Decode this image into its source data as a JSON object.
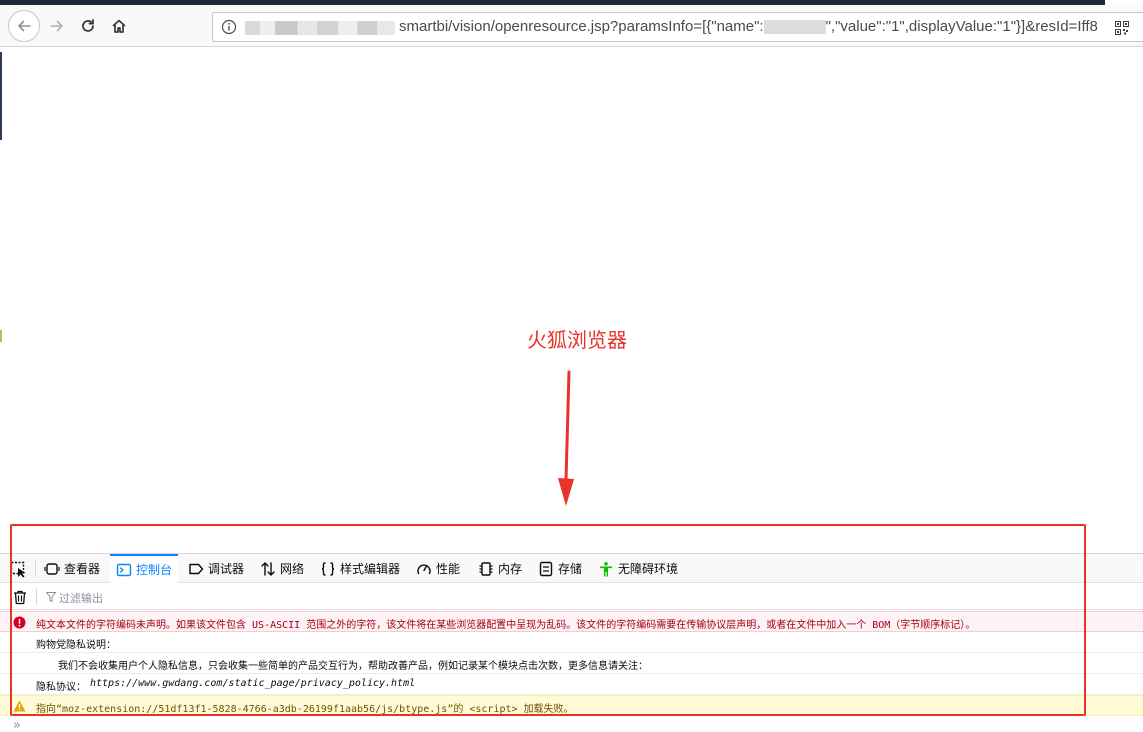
{
  "browser": {
    "url_prefix": "smartbi/vision/openresource.jsp?paramsInfo=[{\"name\":",
    "url_mid": "\",\"value\":\"1\",displayValue:\"1\"}]&resId=Iff8",
    "icons": {
      "back": "back-arrow-icon",
      "forward": "forward-arrow-icon",
      "reload": "reload-icon",
      "home": "home-icon",
      "site_info": "info-icon",
      "qr": "qr-code-icon"
    }
  },
  "annotation": {
    "label": "火狐浏览器",
    "color": "#e8322a"
  },
  "devtools": {
    "tabs": [
      {
        "label": "查看器",
        "icon": "inspector-icon",
        "selected": false
      },
      {
        "label": "控制台",
        "icon": "console-icon",
        "selected": true
      },
      {
        "label": "调试器",
        "icon": "debugger-icon",
        "selected": false
      },
      {
        "label": "网络",
        "icon": "network-icon",
        "selected": false
      },
      {
        "label": "样式编辑器",
        "icon": "style-editor-icon",
        "selected": false
      },
      {
        "label": "性能",
        "icon": "performance-icon",
        "selected": false
      },
      {
        "label": "内存",
        "icon": "memory-icon",
        "selected": false
      },
      {
        "label": "存储",
        "icon": "storage-icon",
        "selected": false
      },
      {
        "label": "无障碍环境",
        "icon": "accessibility-icon",
        "selected": false
      }
    ],
    "filter_placeholder": "过滤输出",
    "messages": {
      "error": "纯文本文件的字符编码未声明。如果该文件包含 US-ASCII 范围之外的字符，该文件将在某些浏览器配置中呈现为乱码。该文件的字符编码需要在传输协议层声明，或者在文件中加入一个 BOM（字节顺序标记）。",
      "log1": "购物党隐私说明：",
      "log2": "我们不会收集用户个人隐私信息，只会收集一些简单的产品交互行为，帮助改善产品，例如记录某个模块点击次数，更多信息请关注：",
      "log3_label": "隐私协议：",
      "log3_link": "https://www.gwdang.com/static_page/privacy_policy.html",
      "warning": "指向“moz-extension://51df13f1-5828-4766-a3db-26199f1aab56/js/btype.js”的 <script> 加载失败。"
    },
    "colors": {
      "accent": "#0a84ff",
      "error_bg": "#fdf2f5",
      "error_text": "#a4000f",
      "warning_bg": "#fffbd6",
      "warning_text": "#715100"
    }
  }
}
